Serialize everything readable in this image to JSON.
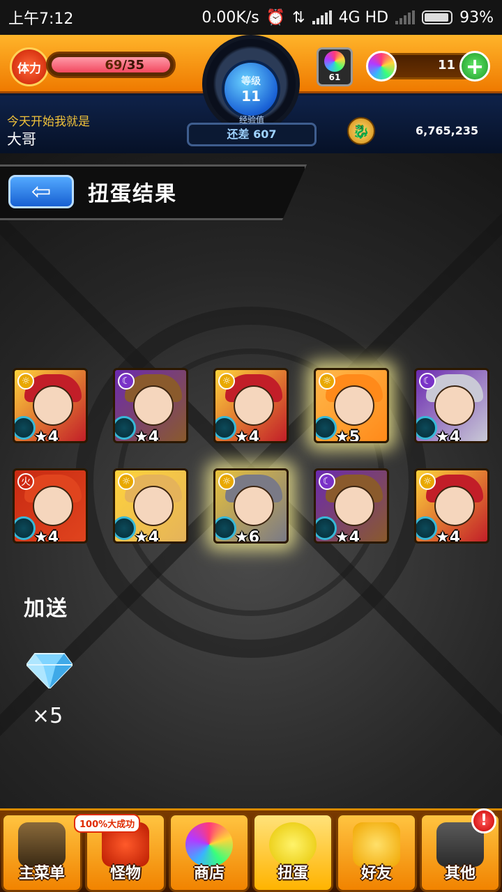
{
  "status_bar": {
    "time": "上午7:12",
    "speed": "0.00K/s",
    "network": "4G HD",
    "battery": "93%",
    "battery_level": 0.93
  },
  "header": {
    "stamina_label": "体力",
    "stamina_current": "69",
    "stamina_max": "/35",
    "level_label": "等级",
    "level_value": "11",
    "exp_label": "经验值",
    "exp_remaining": "还差 607",
    "orb_count": "61",
    "gem_count": "11",
    "motto": "今天开始我就是",
    "player_name": "大哥",
    "coins": "6,765,235"
  },
  "page": {
    "title": "扭蛋结果"
  },
  "results": [
    {
      "stars": "★4",
      "element": "light",
      "palette": [
        "#ffd33b",
        "#c21e28"
      ]
    },
    {
      "stars": "★4",
      "element": "dark",
      "palette": [
        "#6b2ab0",
        "#8a5a2c"
      ]
    },
    {
      "stars": "★4",
      "element": "light",
      "palette": [
        "#ffd33b",
        "#c21e28"
      ]
    },
    {
      "stars": "★5",
      "element": "light",
      "palette": [
        "#ffb84a",
        "#ff8a1a"
      ],
      "glow": true
    },
    {
      "stars": "★4",
      "element": "dark",
      "palette": [
        "#6b2ab0",
        "#c9c9d6"
      ]
    },
    {
      "stars": "★4",
      "element": "fire",
      "palette": [
        "#c82a12",
        "#e0441e"
      ]
    },
    {
      "stars": "★4",
      "element": "light",
      "palette": [
        "#ffd33b",
        "#e5b35a"
      ]
    },
    {
      "stars": "★6",
      "element": "light",
      "palette": [
        "#e9c23b",
        "#7a7a86"
      ],
      "glow": true
    },
    {
      "stars": "★4",
      "element": "dark",
      "palette": [
        "#6b2ab0",
        "#8a5a2c"
      ]
    },
    {
      "stars": "★4",
      "element": "light",
      "palette": [
        "#ffd33b",
        "#c21e28"
      ]
    }
  ],
  "bonus": {
    "label": "加送",
    "count": "×5",
    "icon": "diamond-icon"
  },
  "bottom_nav": {
    "promo": "100%大成功",
    "alert": "!",
    "items": [
      {
        "label": "主菜单",
        "icon": "gate-icon"
      },
      {
        "label": "怪物",
        "icon": "monster-icon"
      },
      {
        "label": "商店",
        "icon": "orb-icon"
      },
      {
        "label": "扭蛋",
        "icon": "egg-icon"
      },
      {
        "label": "好友",
        "icon": "friends-icon"
      },
      {
        "label": "其他",
        "icon": "other-icon"
      }
    ]
  },
  "colors": {
    "accent_orange": "#f07400",
    "navy": "#07142c",
    "light_element": "#ffd33b",
    "dark_element": "#6b2ab0",
    "fire_element": "#c82a12"
  }
}
